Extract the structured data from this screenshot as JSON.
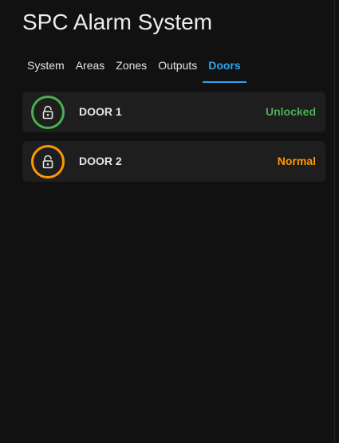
{
  "header": {
    "title": "SPC Alarm System"
  },
  "tabs": [
    {
      "label": "System"
    },
    {
      "label": "Areas"
    },
    {
      "label": "Zones"
    },
    {
      "label": "Outputs"
    },
    {
      "label": "Doors",
      "active": true
    }
  ],
  "doors": [
    {
      "name": "DOOR 1",
      "state": "Unlocked",
      "state_color": "#4caf50",
      "icon": "lock-icon"
    },
    {
      "name": "DOOR 2",
      "state": "Normal",
      "state_color": "#ff9800",
      "icon": "lock-icon"
    }
  ],
  "colors": {
    "background": "#111111",
    "card": "#1e1e1e",
    "accent": "#2ea3f2",
    "unlocked": "#4caf50",
    "normal": "#ff9800"
  }
}
